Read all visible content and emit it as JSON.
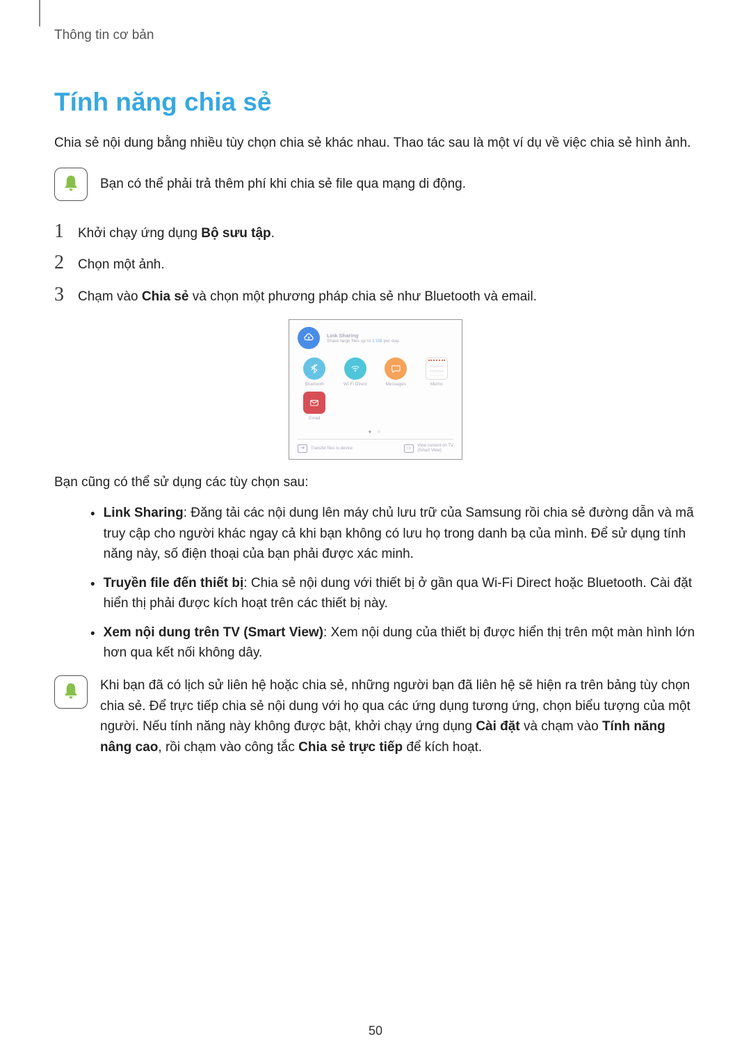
{
  "section_header": "Thông tin cơ bản",
  "title": "Tính năng chia sẻ",
  "intro": "Chia sẻ nội dung bằng nhiều tùy chọn chia sẻ khác nhau. Thao tác sau là một ví dụ về việc chia sẻ hình ảnh.",
  "note1": "Bạn có thể phải trả thêm phí khi chia sẻ file qua mạng di động.",
  "steps": {
    "s1_prefix": "Khởi chạy ứng dụng ",
    "s1_bold": "Bộ sưu tập",
    "s1_suffix": ".",
    "s2": "Chọn một ảnh.",
    "s3_prefix": "Chạm vào ",
    "s3_bold": "Chia sẻ",
    "s3_suffix": " và chọn một phương pháp chia sẻ như Bluetooth và email."
  },
  "share_panel": {
    "link_title": "Link Sharing",
    "link_sub_a": "Share large files up to ",
    "link_sub_b": "2 GB",
    "link_sub_c": " per day.",
    "icons": {
      "bluetooth": "Bluetooth",
      "wifi": "Wi-Fi Direct",
      "messages": "Messages",
      "memo": "Memo",
      "email": "Email"
    },
    "bottom_transfer": "Transfer files to device",
    "bottom_tv_a": "View content on TV",
    "bottom_tv_b": "(Smart View)"
  },
  "sub_heading": "Bạn cũng có thể sử dụng các tùy chọn sau:",
  "bullets": {
    "b1_bold": "Link Sharing",
    "b1_text": ": Đăng tải các nội dung lên máy chủ lưu trữ của Samsung rồi chia sẻ đường dẫn và mã truy cập cho người khác ngay cả khi bạn không có lưu họ trong danh bạ của mình. Để sử dụng tính năng này, số điện thoại của bạn phải được xác minh.",
    "b2_bold": "Truyền file đến thiết bị",
    "b2_text": ": Chia sẻ nội dung với thiết bị ở gần qua Wi-Fi Direct hoặc Bluetooth. Cài đặt hiển thị phải được kích hoạt trên các thiết bị này.",
    "b3_bold": "Xem nội dung trên TV (Smart View)",
    "b3_text": ": Xem nội dung của thiết bị được hiển thị trên một màn hình lớn hơn qua kết nối không dây."
  },
  "note2": {
    "prefix": "Khi bạn đã có lịch sử liên hệ hoặc chia sẻ, những người bạn đã liên hệ sẽ hiện ra trên bảng tùy chọn chia sẻ. Để trực tiếp chia sẻ nội dung với họ qua các ứng dụng tương ứng, chọn biểu tượng của một người. Nếu tính năng này không được bật, khởi chạy ứng dụng ",
    "bold1": "Cài đặt",
    "mid1": " và chạm vào ",
    "bold2": "Tính năng nâng cao",
    "mid2": ", rồi chạm vào công tắc ",
    "bold3": "Chia sẻ trực tiếp",
    "suffix": " để kích hoạt."
  },
  "page_number": "50"
}
